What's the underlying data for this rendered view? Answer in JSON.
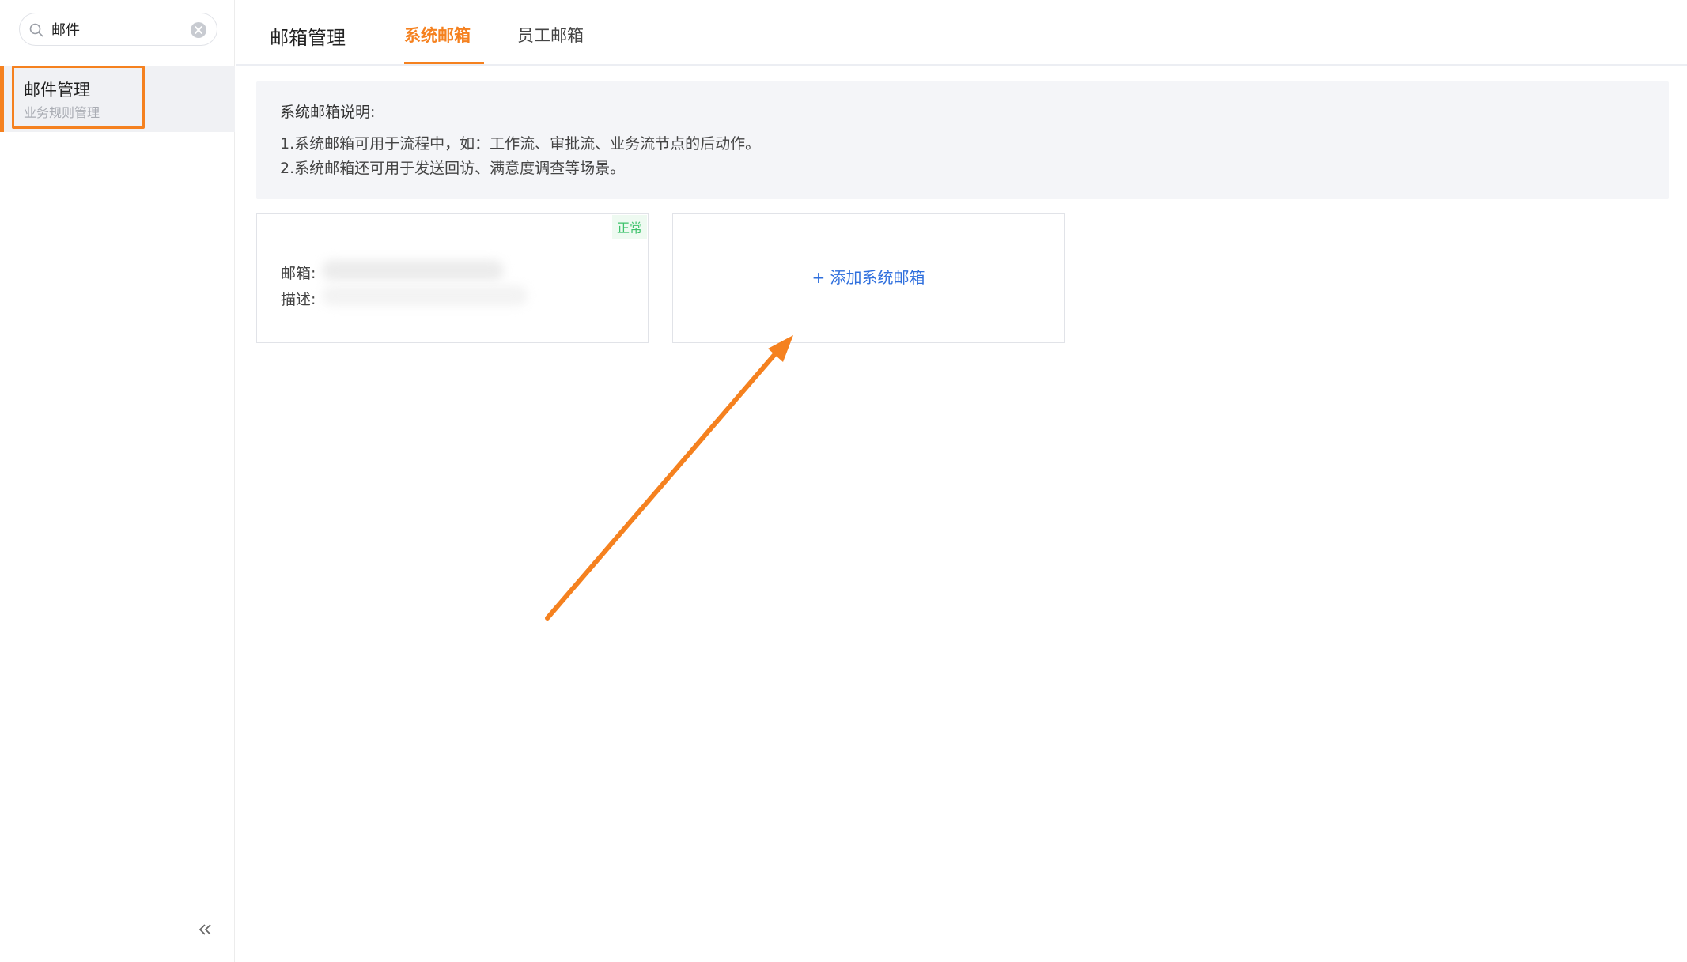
{
  "sidebar": {
    "search": {
      "value": "邮件",
      "placeholder": ""
    },
    "menu_item": {
      "title": "邮件管理",
      "subtitle": "业务规则管理"
    }
  },
  "header": {
    "title": "邮箱管理",
    "tabs": [
      {
        "label": "系统邮箱",
        "active": true
      },
      {
        "label": "员工邮箱",
        "active": false
      }
    ]
  },
  "info": {
    "title": "系统邮箱说明:",
    "lines": [
      "1.系统邮箱可用于流程中，如：工作流、审批流、业务流节点的后动作。",
      "2.系统邮箱还可用于发送回访、满意度调查等场景。"
    ]
  },
  "mailbox_card": {
    "status": "正常",
    "email_label": "邮箱:",
    "description_label": "描述:"
  },
  "add_card": {
    "label": "+ 添加系统邮箱"
  },
  "colors": {
    "accent": "#f5811f",
    "link": "#2f6fdd",
    "status_green": "#3ec26b",
    "panel_bg": "#f4f5f8"
  },
  "icons": {
    "search": "search-icon",
    "clear": "clear-icon",
    "collapse": "double-chevron-left-icon"
  }
}
